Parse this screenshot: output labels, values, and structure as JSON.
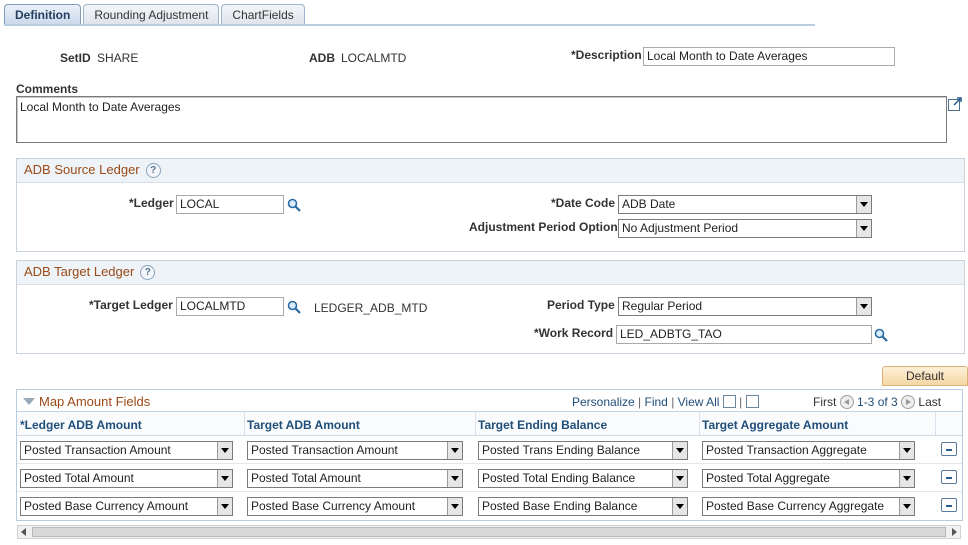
{
  "tabs": [
    {
      "label": "Definition"
    },
    {
      "label": "Rounding Adjustment"
    },
    {
      "label": "ChartFields"
    }
  ],
  "header": {
    "setid_label": "SetID",
    "setid_value": "SHARE",
    "adb_label": "ADB",
    "adb_value": "LOCALMTD",
    "description_label": "*Description",
    "description_value": "Local Month to Date Averages",
    "comments_label": "Comments",
    "comments_value": "Local Month to Date Averages"
  },
  "source": {
    "title": "ADB Source Ledger",
    "ledger_label": "*Ledger",
    "ledger_value": "LOCAL",
    "date_code_label": "*Date Code",
    "date_code_value": "ADB Date",
    "adj_label": "Adjustment Period Option",
    "adj_value": "No Adjustment Period"
  },
  "target": {
    "title": "ADB Target Ledger",
    "ledger_label": "*Target Ledger",
    "ledger_value": "LOCALMTD",
    "ledger_desc": "LEDGER_ADB_MTD",
    "period_type_label": "Period Type",
    "period_type_value": "Regular Period",
    "work_record_label": "*Work Record",
    "work_record_value": "LED_ADBTG_TAO"
  },
  "grid": {
    "default_button": "Default",
    "title": "Map Amount Fields",
    "personalize": "Personalize",
    "find": "Find",
    "view_all": "View All",
    "first": "First",
    "range": "1-3 of 3",
    "last": "Last",
    "columns": [
      "*Ledger ADB Amount",
      "Target ADB Amount",
      "Target Ending Balance",
      "Target Aggregate Amount"
    ],
    "rows": [
      [
        "Posted Transaction Amount",
        "Posted Transaction Amount",
        "Posted Trans Ending Balance",
        "Posted Transaction Aggregate"
      ],
      [
        "Posted Total Amount",
        "Posted Total Amount",
        "Posted Total Ending Balance",
        "Posted Total Aggregate"
      ],
      [
        "Posted Base Currency Amount",
        "Posted Base Currency Amount",
        "Posted Base Ending Balance",
        "Posted Base Currency Aggregate"
      ]
    ]
  }
}
